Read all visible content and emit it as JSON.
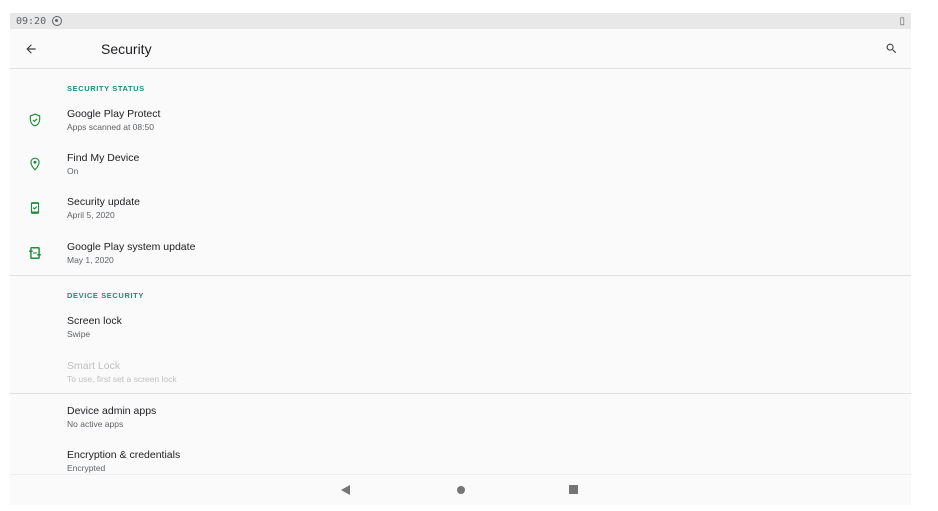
{
  "status_bar": {
    "time": "09:20",
    "battery_glyph": "▯"
  },
  "app_bar": {
    "title": "Security",
    "back_icon": "arrow-back-icon",
    "search_icon": "search-icon"
  },
  "sections": {
    "security_status": {
      "header": "SECURITY STATUS",
      "items": [
        {
          "title": "Google Play Protect",
          "summary": "Apps scanned at 08:50",
          "icon": "shield-check-icon"
        },
        {
          "title": "Find My Device",
          "summary": "On",
          "icon": "location-pin-icon"
        },
        {
          "title": "Security update",
          "summary": "April 5, 2020",
          "icon": "security-update-icon"
        },
        {
          "title": "Google Play system update",
          "summary": "May 1, 2020",
          "icon": "system-update-icon"
        }
      ]
    },
    "device_security": {
      "header": "DEVICE SECURITY",
      "items": [
        {
          "title": "Screen lock",
          "summary": "Swipe"
        },
        {
          "title": "Smart Lock",
          "summary": "To use, first set a screen lock",
          "disabled": true
        }
      ]
    },
    "other": {
      "items": [
        {
          "title": "Device admin apps",
          "summary": "No active apps"
        },
        {
          "title": "Encryption & credentials",
          "summary": "Encrypted"
        }
      ]
    }
  },
  "colors": {
    "accent": "#1a8e7e",
    "icon": "#1e8e3e"
  }
}
